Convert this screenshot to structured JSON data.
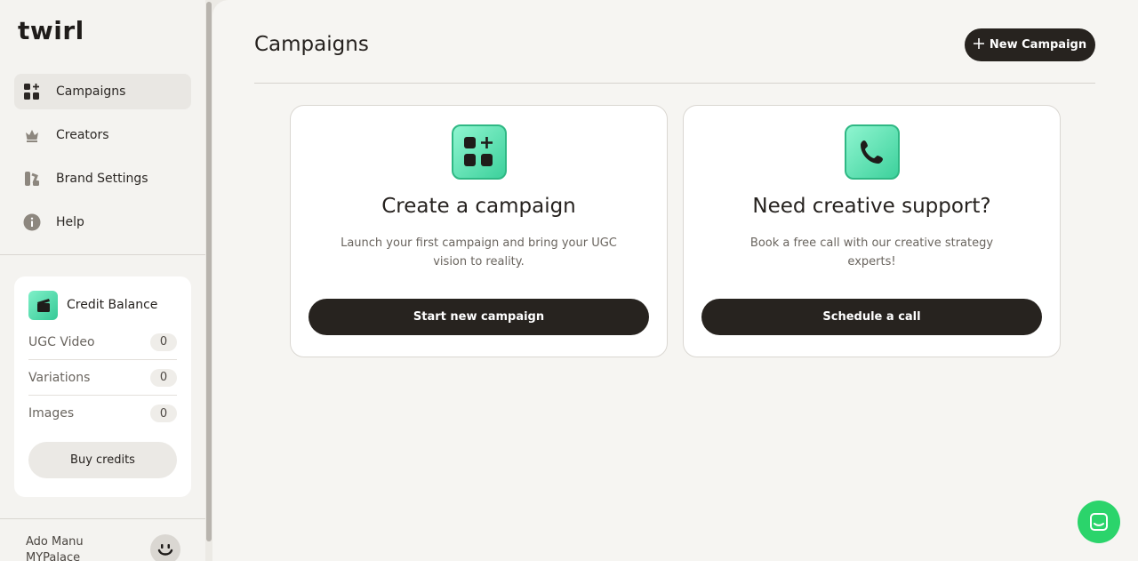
{
  "sidebar": {
    "logo": "twirl",
    "nav": [
      {
        "label": "Campaigns",
        "icon": "grid-plus-icon",
        "active": true
      },
      {
        "label": "Creators",
        "icon": "crown-icon"
      },
      {
        "label": "Brand Settings",
        "icon": "palette-icon"
      },
      {
        "label": "Help",
        "icon": "info-icon"
      }
    ],
    "credits": {
      "title": "Credit Balance",
      "rows": [
        {
          "label": "UGC Video",
          "count": "0"
        },
        {
          "label": "Variations",
          "count": "0"
        },
        {
          "label": "Images",
          "count": "0"
        }
      ],
      "buy_label": "Buy credits"
    },
    "user": {
      "name": "Ado Manu",
      "org": "MYPalace"
    }
  },
  "main": {
    "title": "Campaigns",
    "new_button": "New Campaign",
    "cards": [
      {
        "title": "Create a campaign",
        "description": "Launch your first campaign and bring your UGC vision to reality.",
        "button": "Start new campaign",
        "icon": "grid-plus-icon"
      },
      {
        "title": "Need creative support?",
        "description": "Book a free call with our creative strategy experts!",
        "button": "Schedule a call",
        "icon": "phone-icon"
      }
    ]
  },
  "colors": {
    "accent_green": "#3dd19c",
    "dark": "#27231f",
    "chat": "#2bd46b"
  }
}
